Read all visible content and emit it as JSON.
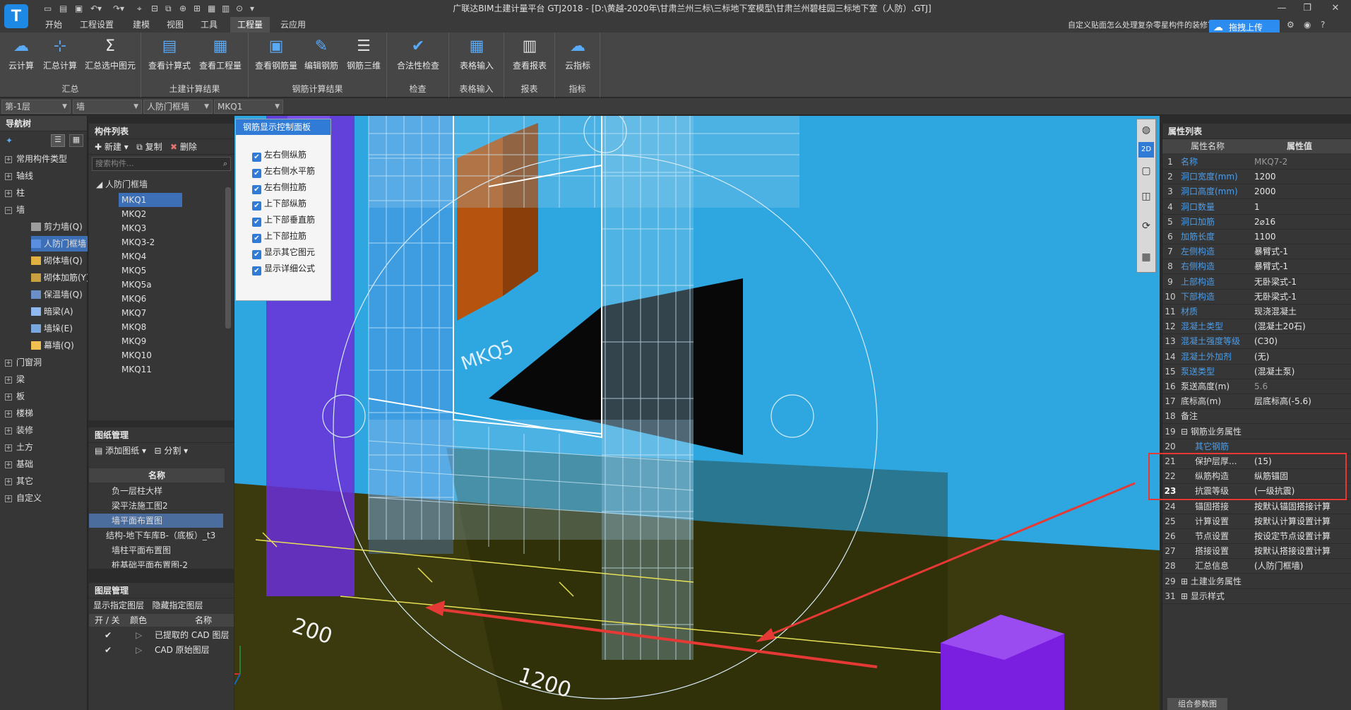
{
  "app": {
    "logo_text": "T",
    "window_title": "广联达BIM土建计量平台 GTJ2018 - [D:\\黄越-2020年\\甘肃兰州三标\\三标地下室模型\\甘肃兰州碧桂园三标地下室（人防）.GTJ]",
    "help_question": "自定义贴面怎么处理复杂零星构件的装修？",
    "upload_label": "拖拽上传"
  },
  "menu": {
    "tabs": [
      "开始",
      "工程设置",
      "建模",
      "视图",
      "工具",
      "工程量",
      "云应用"
    ],
    "active": "工程量"
  },
  "ribbon": {
    "groups": [
      {
        "title": "汇总",
        "buttons": [
          "云计算",
          "汇总计算",
          "汇总选中图元"
        ]
      },
      {
        "title": "土建计算结果",
        "buttons": [
          "查看计算式",
          "查看工程量"
        ]
      },
      {
        "title": "钢筋计算结果",
        "buttons": [
          "查看钢筋量",
          "编辑钢筋",
          "钢筋三维"
        ]
      },
      {
        "title": "检查",
        "buttons": [
          "合法性检查"
        ]
      },
      {
        "title": "表格输入",
        "buttons": [
          "表格输入"
        ]
      },
      {
        "title": "报表",
        "buttons": [
          "查看报表"
        ]
      },
      {
        "title": "指标",
        "buttons": [
          "云指标"
        ]
      }
    ]
  },
  "selectors": {
    "floor": "第-1层",
    "type": "墙",
    "subtype": "人防门框墙",
    "name": "MKQ1"
  },
  "nav": {
    "title": "导航树",
    "items": [
      "常用构件类型",
      "轴线",
      "柱",
      "墙",
      "门窗洞",
      "梁",
      "板",
      "楼梯",
      "装修",
      "土方",
      "基础",
      "其它",
      "自定义"
    ],
    "wall_children": [
      "剪力墙(Q)",
      "人防门框墙",
      "砌体墙(Q)",
      "砌体加筋(Y)",
      "保温墙(Q)",
      "暗梁(A)",
      "墙垛(E)",
      "幕墙(Q)"
    ],
    "active_child": "人防门框墙"
  },
  "components": {
    "title": "构件列表",
    "toolbar": {
      "new": "新建",
      "copy": "复制",
      "delete": "删除"
    },
    "search_placeholder": "搜索构件...",
    "group": "人防门框墙",
    "items": [
      "MKQ1",
      "MKQ2",
      "MKQ3",
      "MKQ3-2",
      "MKQ4",
      "MKQ5",
      "MKQ5a",
      "MKQ6",
      "MKQ7",
      "MKQ8",
      "MKQ9",
      "MKQ10",
      "MKQ11"
    ],
    "selected": "MKQ1"
  },
  "drawings": {
    "title": "图纸管理",
    "toolbar": {
      "add": "添加图纸",
      "split": "分割"
    },
    "col_name": "名称",
    "rows": [
      "负一层柱大样",
      "梁平法施工图2",
      "墙平面布置图",
      "结构-地下车库B-（底板）_t3",
      "墙柱平面布置图",
      "桩基础平面布置图-2"
    ],
    "selected": "墙平面布置图"
  },
  "layers": {
    "title": "图层管理",
    "toolbar": {
      "show": "显示指定图层",
      "hide": "隐藏指定图层"
    },
    "columns": [
      "开 / 关",
      "颜色",
      "名称"
    ],
    "rows": [
      {
        "name": "已提取的 CAD 图层",
        "on": true
      },
      {
        "name": "CAD 原始图层",
        "on": true
      }
    ]
  },
  "rebar_panel": {
    "title": "钢筋显示控制面板",
    "options": [
      "左右侧纵筋",
      "左右侧水平筋",
      "左右侧拉筋",
      "上下部纵筋",
      "上下部垂直筋",
      "上下部拉筋",
      "显示其它图元",
      "显示详细公式"
    ]
  },
  "viewport_labels": {
    "dim1": "1200",
    "dim2": "200",
    "wall_label": "MKQ5"
  },
  "properties": {
    "title": "属性列表",
    "col_name": "属性名称",
    "col_value": "属性值",
    "rows": [
      {
        "n": "1",
        "name": "名称",
        "value": "MKQ7-2",
        "blue": true,
        "dim": true
      },
      {
        "n": "2",
        "name": "洞口宽度(mm)",
        "value": "1200",
        "blue": true
      },
      {
        "n": "3",
        "name": "洞口高度(mm)",
        "value": "2000",
        "blue": true
      },
      {
        "n": "4",
        "name": "洞口数量",
        "value": "1",
        "blue": true
      },
      {
        "n": "5",
        "name": "洞口加筋",
        "value": "2⌀16",
        "blue": true
      },
      {
        "n": "6",
        "name": "加筋长度",
        "value": "1100",
        "blue": true
      },
      {
        "n": "7",
        "name": "左侧构造",
        "value": "暴臂式-1",
        "blue": true
      },
      {
        "n": "8",
        "name": "右侧构造",
        "value": "暴臂式-1",
        "blue": true
      },
      {
        "n": "9",
        "name": "上部构造",
        "value": "无卧梁式-1",
        "blue": true
      },
      {
        "n": "10",
        "name": "下部构造",
        "value": "无卧梁式-1",
        "blue": true
      },
      {
        "n": "11",
        "name": "材质",
        "value": "现浇混凝土",
        "blue": true
      },
      {
        "n": "12",
        "name": "混凝土类型",
        "value": "(混凝土20石)",
        "blue": true
      },
      {
        "n": "13",
        "name": "混凝土强度等级",
        "value": "(C30)",
        "blue": true
      },
      {
        "n": "14",
        "name": "混凝土外加剂",
        "value": "(无)",
        "blue": true
      },
      {
        "n": "15",
        "name": "泵送类型",
        "value": "(混凝土泵)",
        "blue": true
      },
      {
        "n": "16",
        "name": "泵送高度(m)",
        "value": "5.6",
        "blue": false,
        "dim": true
      },
      {
        "n": "17",
        "name": "底标高(m)",
        "value": "层底标高(-5.6)",
        "blue": false
      },
      {
        "n": "18",
        "name": "备注",
        "value": "",
        "blue": false
      },
      {
        "n": "19",
        "name": "⊟ 钢筋业务属性",
        "value": "",
        "blue": false
      },
      {
        "n": "20",
        "name": "其它钢筋",
        "value": "",
        "blue": true,
        "indent": true
      },
      {
        "n": "21",
        "name": "保护层厚...",
        "value": "(15)",
        "blue": false,
        "indent": true
      },
      {
        "n": "22",
        "name": "纵筋构造",
        "value": "纵筋锚固",
        "blue": false,
        "indent": true
      },
      {
        "n": "23",
        "name": "抗震等级",
        "value": "(一级抗震)",
        "blue": false,
        "indent": true,
        "bold": true
      },
      {
        "n": "24",
        "name": "锚固搭接",
        "value": "按默认锚固搭接计算",
        "blue": false,
        "indent": true
      },
      {
        "n": "25",
        "name": "计算设置",
        "value": "按默认计算设置计算",
        "blue": false,
        "indent": true
      },
      {
        "n": "26",
        "name": "节点设置",
        "value": "按设定节点设置计算",
        "blue": false,
        "indent": true
      },
      {
        "n": "27",
        "name": "搭接设置",
        "value": "按默认搭接设置计算",
        "blue": false,
        "indent": true
      },
      {
        "n": "28",
        "name": "汇总信息",
        "value": "(人防门框墙)",
        "blue": false,
        "indent": true
      },
      {
        "n": "29",
        "name": "⊞ 土建业务属性",
        "value": "",
        "blue": false
      },
      {
        "n": "31",
        "name": "⊞ 显示样式",
        "value": "",
        "blue": false
      }
    ],
    "bottom_tab": "组合参数图"
  },
  "colors": {
    "accent": "#2d8cf0",
    "viewport_bg": "#2ea6df",
    "highlight_red": "#e53935",
    "slab": "#4a4a12"
  }
}
